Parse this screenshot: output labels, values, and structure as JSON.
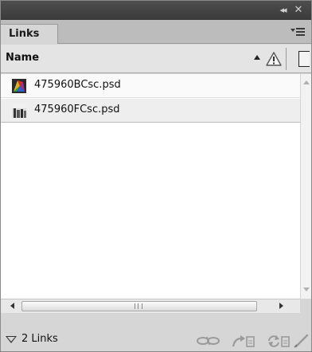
{
  "window": {
    "collapse_label": "◂◂",
    "close_label": "✕"
  },
  "tabs": [
    {
      "label": "Links",
      "active": true
    }
  ],
  "columns": {
    "name_label": "Name",
    "sort_direction": "ascending",
    "status_column_icon": "warning-icon",
    "page_column_icon": "page-icon"
  },
  "links": [
    {
      "name": "475960BCsc.psd",
      "thumbnail_icon": "psd-thumbnail-color"
    },
    {
      "name": "475960FCsc.psd",
      "thumbnail_icon": "psd-thumbnail-bw"
    }
  ],
  "status": {
    "count_label": "2 Links"
  },
  "toolbar": {
    "icons": [
      "relink-icon",
      "go-to-link-icon",
      "update-link-icon",
      "edit-original-icon"
    ]
  },
  "colors": {
    "panel_bg": "#d6d6d6",
    "titlebar_bg": "#3f3f3f",
    "list_bg": "#ffffff",
    "selected_row_bg": "#eeeeee"
  }
}
